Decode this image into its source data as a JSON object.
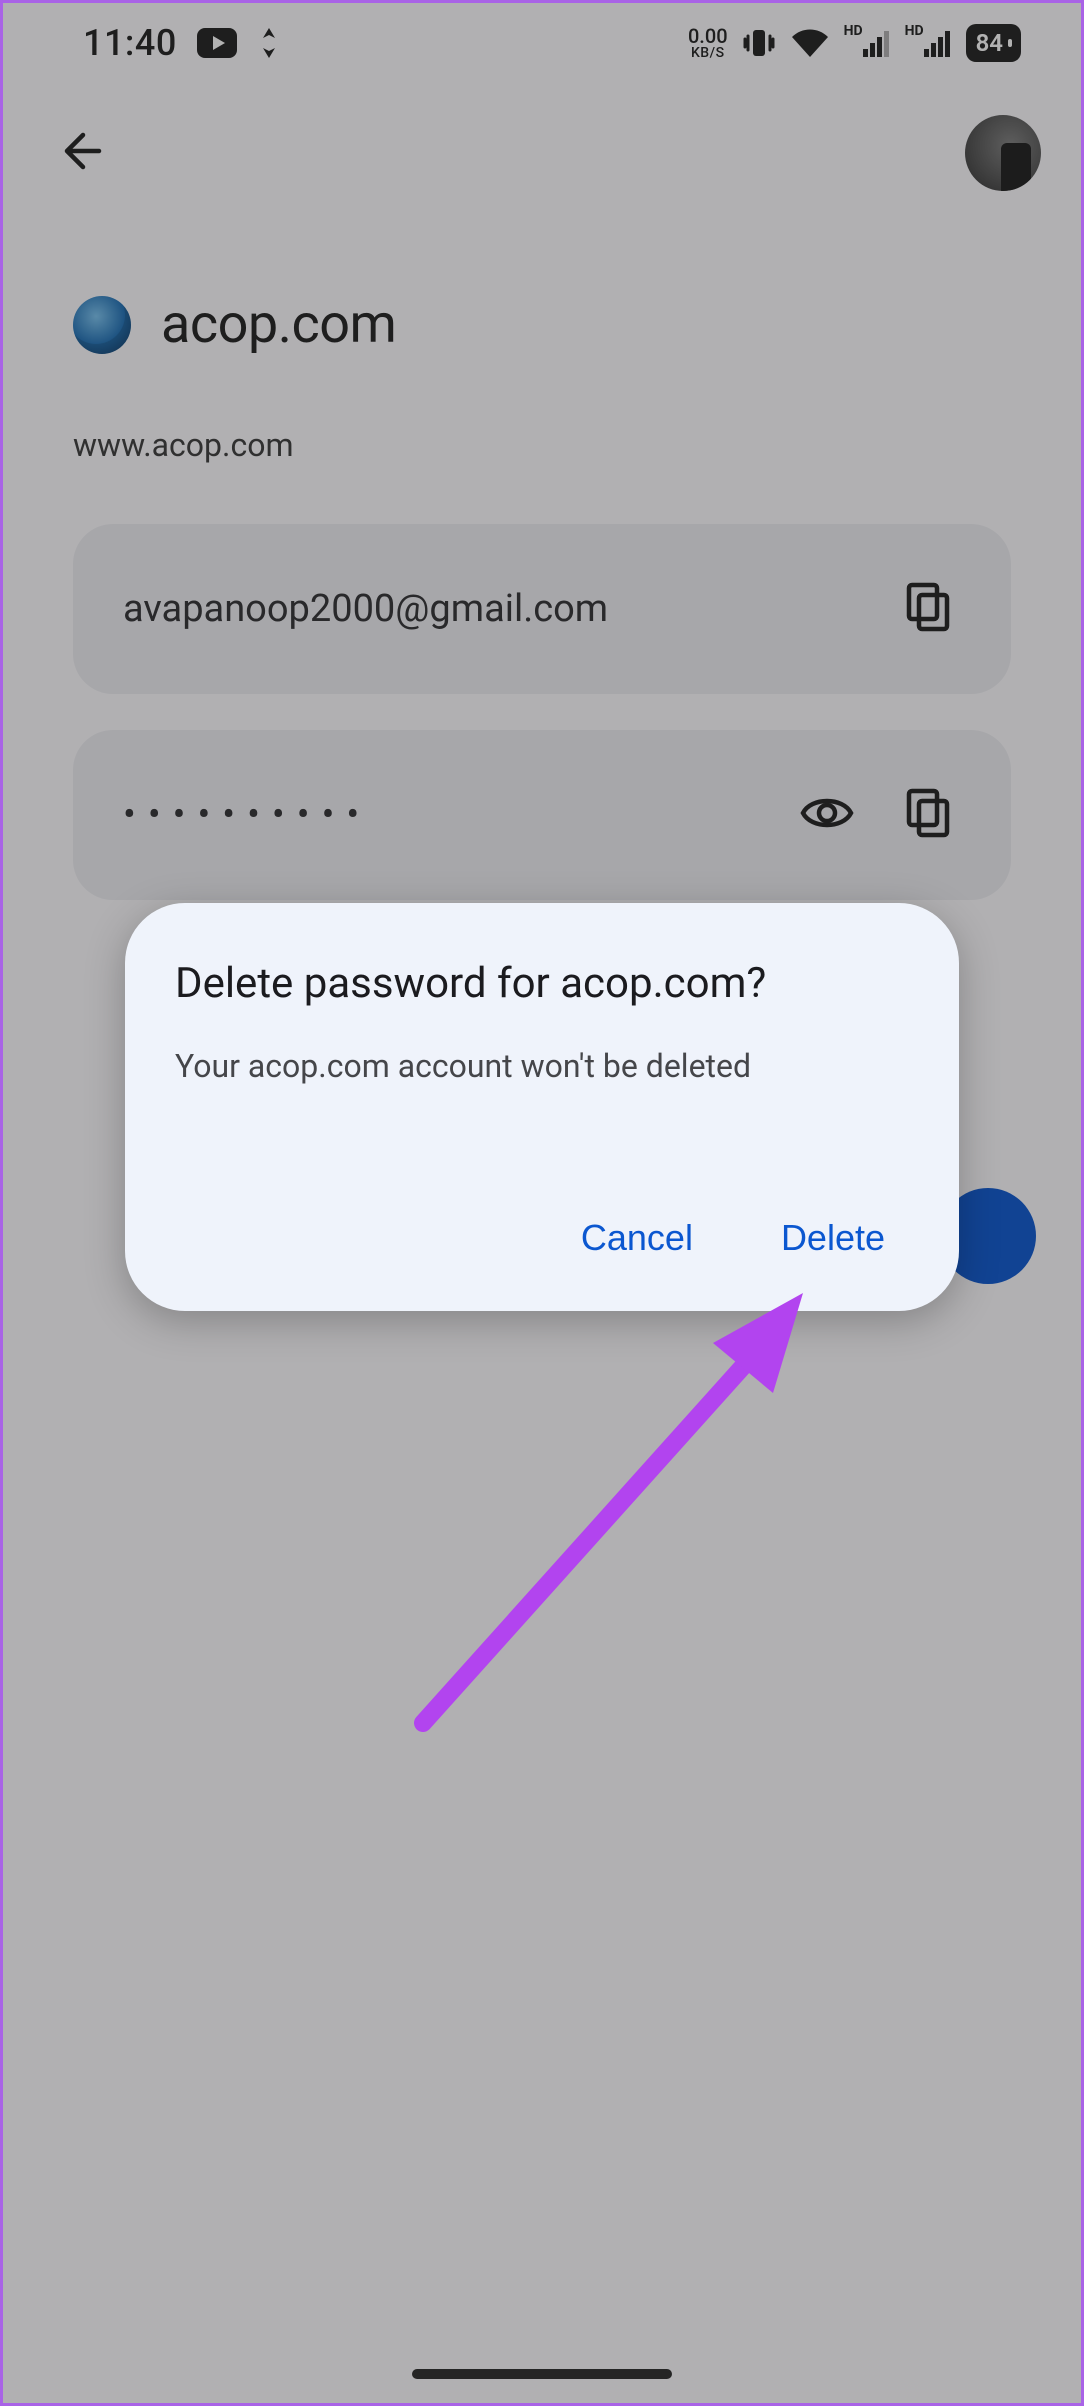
{
  "statusbar": {
    "time": "11:40",
    "data_rate_value": "0.00",
    "data_rate_unit": "KB/S",
    "sim1_label": "HD",
    "sim2_label": "HD",
    "battery_percent": "84"
  },
  "page": {
    "site_title": "acop.com",
    "site_url": "www.acop.com",
    "username": "avapanoop2000@gmail.com",
    "password_masked": "••••••••••"
  },
  "dialog": {
    "title": "Delete password for acop.com?",
    "body": "Your acop.com account won't be deleted",
    "cancel_label": "Cancel",
    "confirm_label": "Delete"
  }
}
